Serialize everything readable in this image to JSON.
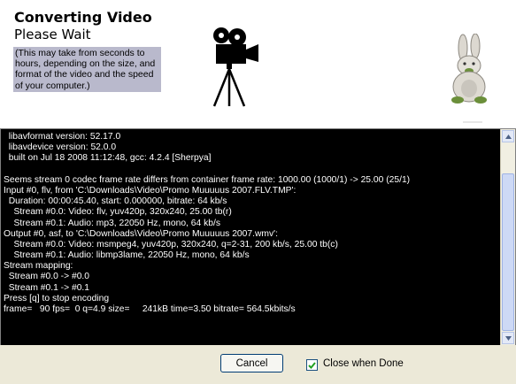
{
  "header": {
    "title": "Converting Video",
    "subtitle": "Please Wait",
    "note_lines": [
      "(This may take from seconds to",
      "hours, depending on the size, and",
      "format of the video and the speed",
      "of your computer.)"
    ]
  },
  "icons": {
    "camera": "movie-camera-icon",
    "mascot": "bunny-mascot-icon",
    "up": "scroll-up-arrow-icon",
    "down": "scroll-down-arrow-icon",
    "check": "checkmark-icon"
  },
  "log_lines": [
    "  libavformat version: 52.17.0",
    "  libavdevice version: 52.0.0",
    "  built on Jul 18 2008 11:12:48, gcc: 4.2.4 [Sherpya]",
    "",
    "Seems stream 0 codec frame rate differs from container frame rate: 1000.00 (1000/1) -> 25.00 (25/1)",
    "Input #0, flv, from 'C:\\Downloads\\Video\\Promo Muuuuus 2007.FLV.TMP':",
    "  Duration: 00:00:45.40, start: 0.000000, bitrate: 64 kb/s",
    "    Stream #0.0: Video: flv, yuv420p, 320x240, 25.00 tb(r)",
    "    Stream #0.1: Audio: mp3, 22050 Hz, mono, 64 kb/s",
    "Output #0, asf, to 'C:\\Downloads\\Video\\Promo Muuuuus 2007.wmv':",
    "    Stream #0.0: Video: msmpeg4, yuv420p, 320x240, q=2-31, 200 kb/s, 25.00 tb(c)",
    "    Stream #0.1: Audio: libmp3lame, 22050 Hz, mono, 64 kb/s",
    "Stream mapping:",
    "  Stream #0.0 -> #0.0",
    "  Stream #0.1 -> #0.1",
    "Press [q] to stop encoding",
    "frame=   90 fps=  0 q=4.9 size=     241kB time=3.50 bitrate= 564.5kbits/s"
  ],
  "footer": {
    "cancel_label": "Cancel",
    "close_when_done_label": "Close when Done",
    "close_when_done_checked": true
  }
}
